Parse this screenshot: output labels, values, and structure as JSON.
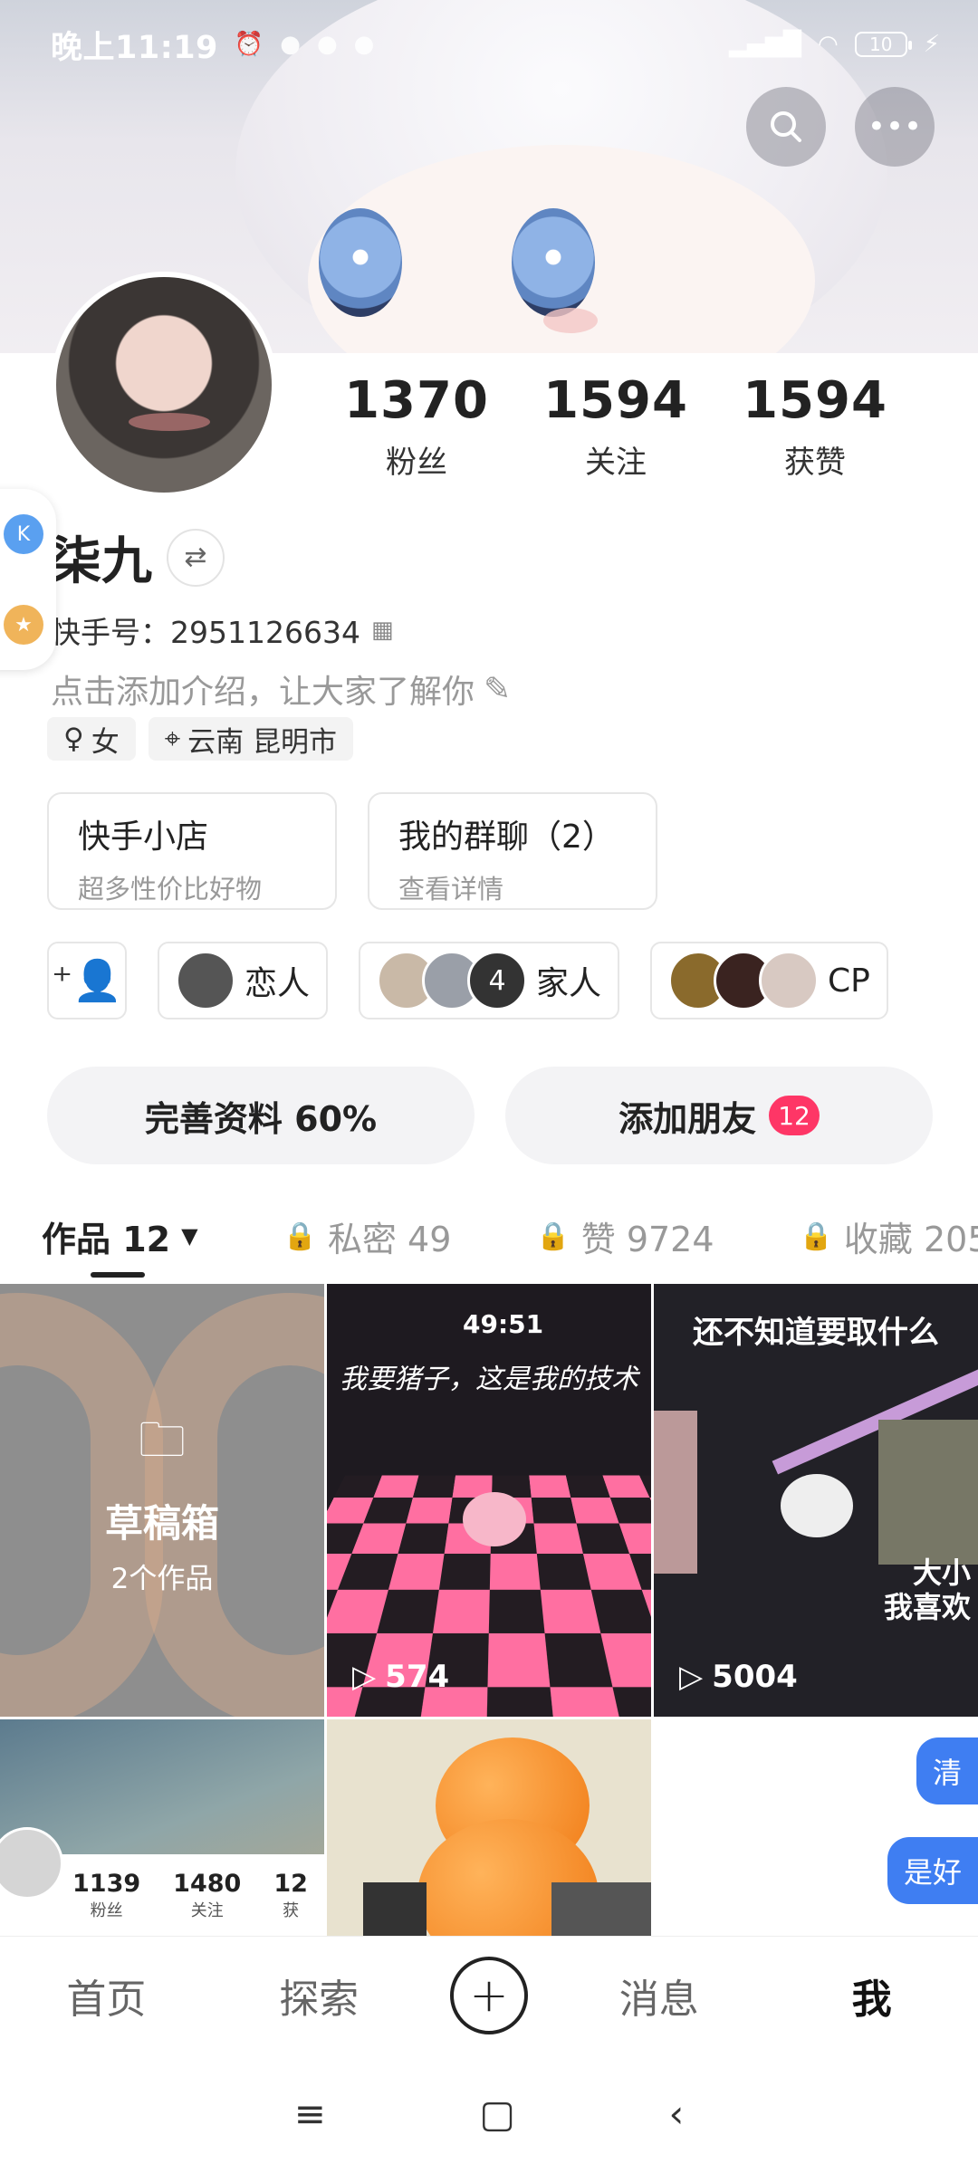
{
  "status_bar": {
    "time": "晚上11:19",
    "battery": "10"
  },
  "profile": {
    "stats": [
      {
        "num": "1370",
        "label": "粉丝"
      },
      {
        "num": "1594",
        "label": "关注"
      },
      {
        "num": "1594",
        "label": "获赞"
      }
    ],
    "name": "柒九",
    "kuaishou_id_label": "快手号：2951126634",
    "intro_placeholder": "点击添加介绍，让大家了解你",
    "gender_tag": "女",
    "location_tag": "云南 昆明市"
  },
  "shortcuts": [
    {
      "title": "快手小店",
      "subtitle": "超多性价比好物"
    },
    {
      "title": "我的群聊（2）",
      "subtitle": "查看详情"
    }
  ],
  "relations": {
    "lover_label": "恋人",
    "family_count": "4",
    "family_label": "家人",
    "third_label": "CP"
  },
  "actions": {
    "complete_profile": "完善资料 60%",
    "add_friends": "添加朋友",
    "add_friends_badge": "12"
  },
  "tabs": [
    {
      "label": "作品 12",
      "active": true
    },
    {
      "label": "私密 49",
      "locked": true
    },
    {
      "label": "赞 9724",
      "locked": true
    },
    {
      "label": "收藏 205",
      "locked": true
    }
  ],
  "grid": {
    "draft_title": "草稿箱",
    "draft_subtitle": "2个作品",
    "video2_caption": "我要猪子，这是我的技术",
    "video2_timer": "49:51",
    "video2_plays": "574",
    "video3_caption": "还不知道要取什么",
    "video3_sub": "大小\n我喜欢",
    "video3_plays": "5004",
    "mini_stats": [
      {
        "num": "1139",
        "label": "粉丝"
      },
      {
        "num": "1480",
        "label": "关注"
      },
      {
        "num": "12",
        "label": "获"
      }
    ],
    "chip1": "清",
    "chip2": "是好"
  },
  "bottom_nav": {
    "home": "首页",
    "explore": "探索",
    "messages": "消息",
    "me": "我"
  },
  "colors": {
    "accent_badge": "#fe3666",
    "chip_blue": "#3f7ef2"
  }
}
